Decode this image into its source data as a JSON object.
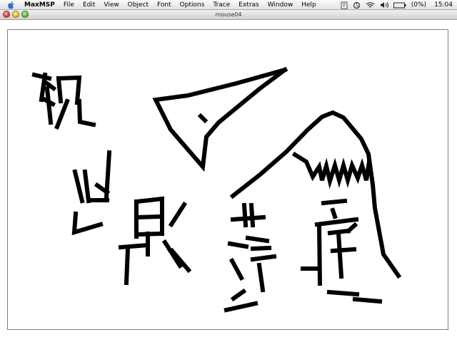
{
  "menubar": {
    "app_name": "MaxMSP",
    "menus": [
      "File",
      "Edit",
      "View",
      "Object",
      "Font",
      "Options",
      "Trace",
      "Extras",
      "Window",
      "Help"
    ],
    "status_icons": [
      "apple-icon",
      "script-icon",
      "sync-icon",
      "wifi-icon",
      "volume-icon",
      "battery-icon"
    ],
    "battery_text": "(0%)",
    "clock": "15:04"
  },
  "window": {
    "title": "mouse04"
  },
  "colors": {
    "ink": "#000000",
    "canvas": "#ffffff"
  }
}
